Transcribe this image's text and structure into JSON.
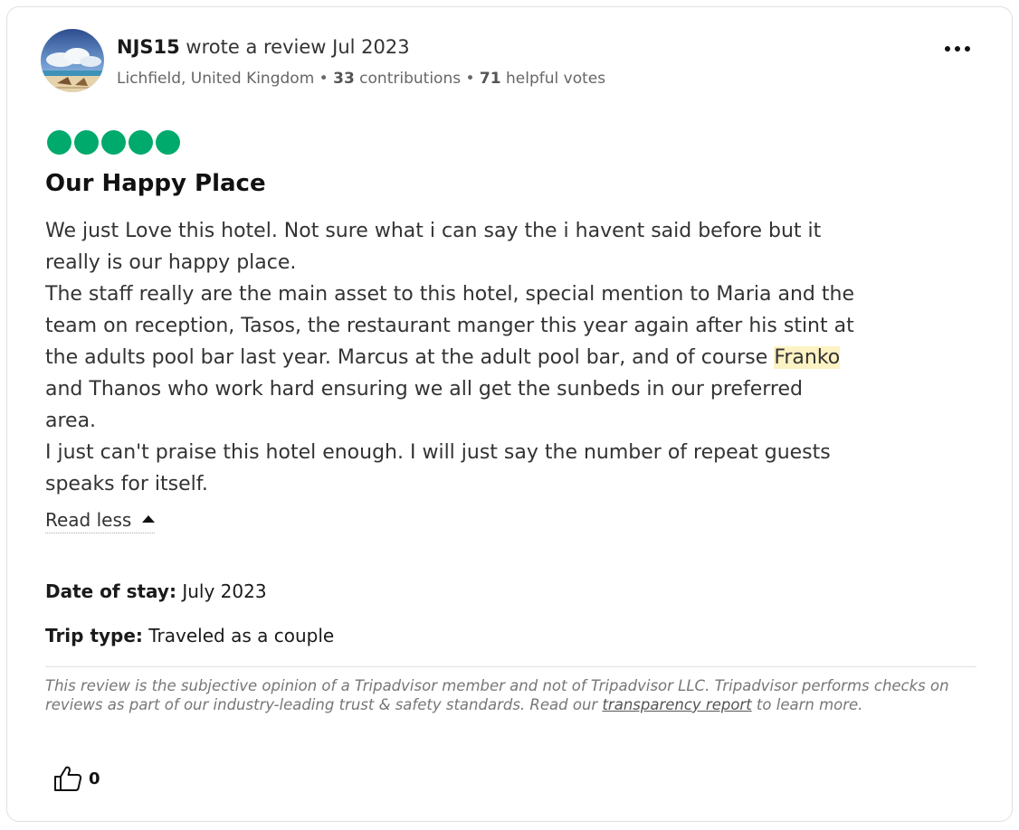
{
  "review": {
    "username": "NJS15",
    "wrote_label": " wrote a review Jul 2023",
    "location": "Lichfield, United Kingdom",
    "sep": " • ",
    "contributions_count": "33",
    "contributions_label": " contributions",
    "helpful_votes_count": "71",
    "helpful_votes_label": " helpful votes",
    "rating": 5,
    "rating_color": "#00aa6c",
    "title": "Our Happy Place",
    "body_lines": [
      "We just Love this hotel. Not sure what i can say the i havent said before but it",
      "really is our happy place.",
      "The staff really are the main asset to this hotel, special mention to Maria and the",
      "team on reception, Tasos, the restaurant manger this year again after his stint at",
      "the adults pool bar last year. Marcus at the adult pool bar, and of course ",
      "and Thanos who work hard ensuring we all get the sunbeds in our preferred",
      "area.",
      "I just can't praise this hotel enough. I will just say the number of repeat guests",
      "speaks for itself."
    ],
    "highlight_word": "Franko",
    "highlight_color": "#fdf2c4",
    "read_less_label": "Read less",
    "date_of_stay_label": "Date of stay:",
    "date_of_stay_value": " July 2023",
    "trip_type_label": "Trip type:",
    "trip_type_value": " Traveled as a couple",
    "disclaimer_text": "This review is the subjective opinion of a Tripadvisor member and not of Tripadvisor LLC. Tripadvisor performs checks on reviews as part of our industry-leading trust & safety standards. Read our ",
    "disclaimer_link": "transparency report",
    "disclaimer_end": " to learn more.",
    "helpful_count": "0",
    "icons": {
      "more": "more-options-icon",
      "readless": "caret-up-icon",
      "helpful": "thumbs-up-icon"
    }
  }
}
